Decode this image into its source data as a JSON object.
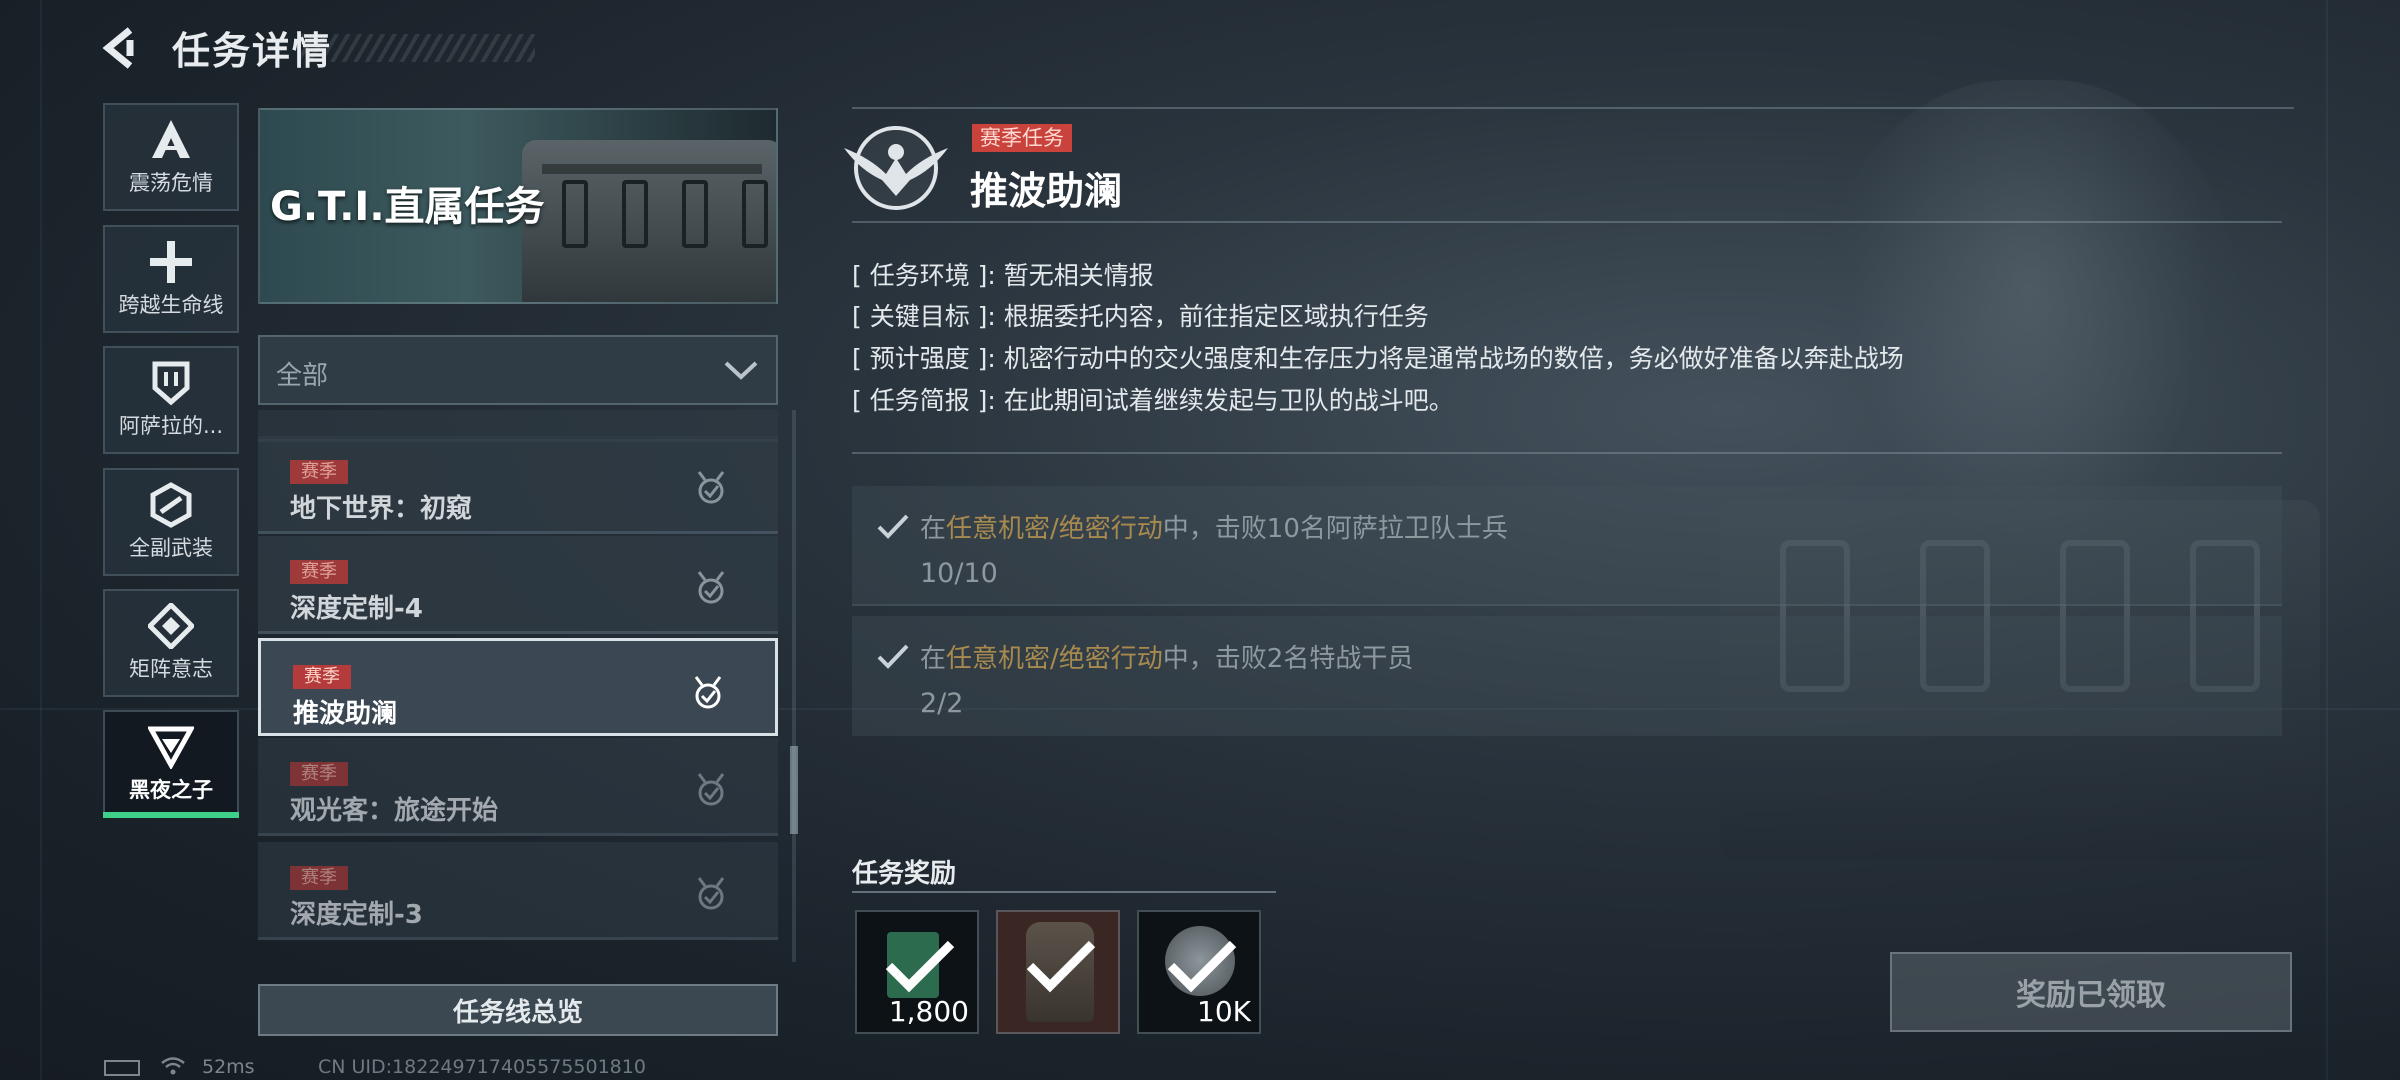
{
  "header": {
    "title": "任务详情"
  },
  "categories": [
    {
      "label": "震荡危情",
      "icon": "A-glyph-icon"
    },
    {
      "label": "跨越生命线",
      "icon": "cross-icon"
    },
    {
      "label": "阿萨拉的...",
      "icon": "shield-icon"
    },
    {
      "label": "全副武装",
      "icon": "hex-link-icon"
    },
    {
      "label": "矩阵意志",
      "icon": "diamond-icon"
    },
    {
      "label": "黑夜之子",
      "icon": "V-glyph-icon",
      "active": true
    }
  ],
  "banner": {
    "title": "G.T.I.直属任务"
  },
  "filter": {
    "selected": "全部"
  },
  "task_list": [
    {
      "tag": "赛季",
      "name": "地下世界：初窥"
    },
    {
      "tag": "赛季",
      "name": "深度定制-4"
    },
    {
      "tag": "赛季",
      "name": "推波助澜",
      "selected": true
    },
    {
      "tag": "赛季",
      "name": "观光客：旅途开始"
    },
    {
      "tag": "赛季",
      "name": "深度定制-3"
    }
  ],
  "overview_button": "任务线总览",
  "detail": {
    "tag": "赛季任务",
    "title": "推波助澜",
    "info": [
      {
        "key": "[ 任务环境 ]:",
        "value": "暂无相关情报"
      },
      {
        "key": "[ 关键目标 ]:",
        "value": "根据委托内容，前往指定区域执行任务"
      },
      {
        "key": "[ 预计强度 ]:",
        "value": "机密行动中的交火强度和生存压力将是通常战场的数倍，务必做好准备以奔赴战场"
      },
      {
        "key": "[ 任务简报 ]:",
        "value": "在此期间试着继续发起与卫队的战斗吧。"
      }
    ],
    "objectives": [
      {
        "pre": "在",
        "highlight": "任意机密/绝密行动",
        "post": "中，击败10名阿萨拉卫队士兵",
        "progress": "10/10"
      },
      {
        "pre": "在",
        "highlight": "任意机密/绝密行动",
        "post": "中，击败2名特战干员",
        "progress": "2/2"
      }
    ]
  },
  "rewards": {
    "title": "任务奖励",
    "items": [
      {
        "icon": "currency-icon",
        "amount": "1,800"
      },
      {
        "icon": "armor-vest-icon",
        "amount": ""
      },
      {
        "icon": "coin-icon",
        "amount": "10K"
      }
    ]
  },
  "claim_button": "奖励已领取",
  "status": {
    "ping": "52ms",
    "uid": "CN UID:18224971740557550181​0"
  },
  "colors": {
    "accent_green": "#3fd08a",
    "tag_red": "#c9423c",
    "objective_highlight": "#a88a4e"
  }
}
